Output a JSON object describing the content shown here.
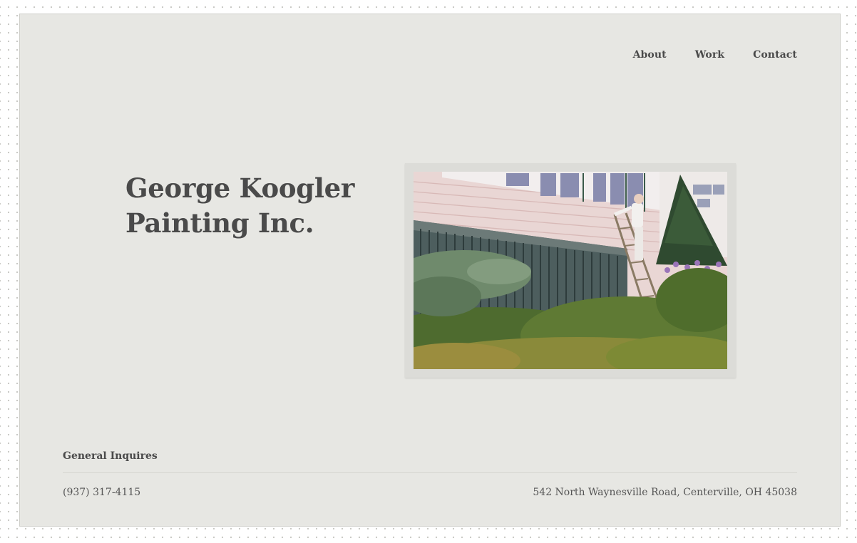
{
  "nav": {
    "items": [
      {
        "label": "About"
      },
      {
        "label": "Work"
      },
      {
        "label": "Contact"
      }
    ]
  },
  "hero": {
    "title_line1": "George Koogler",
    "title_line2": "Painting Inc."
  },
  "footer": {
    "label": "General Inquires",
    "phone": "(937) 317-4115",
    "address": "542 North Waynesville Road, Centerville, OH 45038"
  },
  "colors": {
    "page_background": "#e7e7e3",
    "text": "#4a4a4a",
    "rule": "#d4d4cf"
  }
}
